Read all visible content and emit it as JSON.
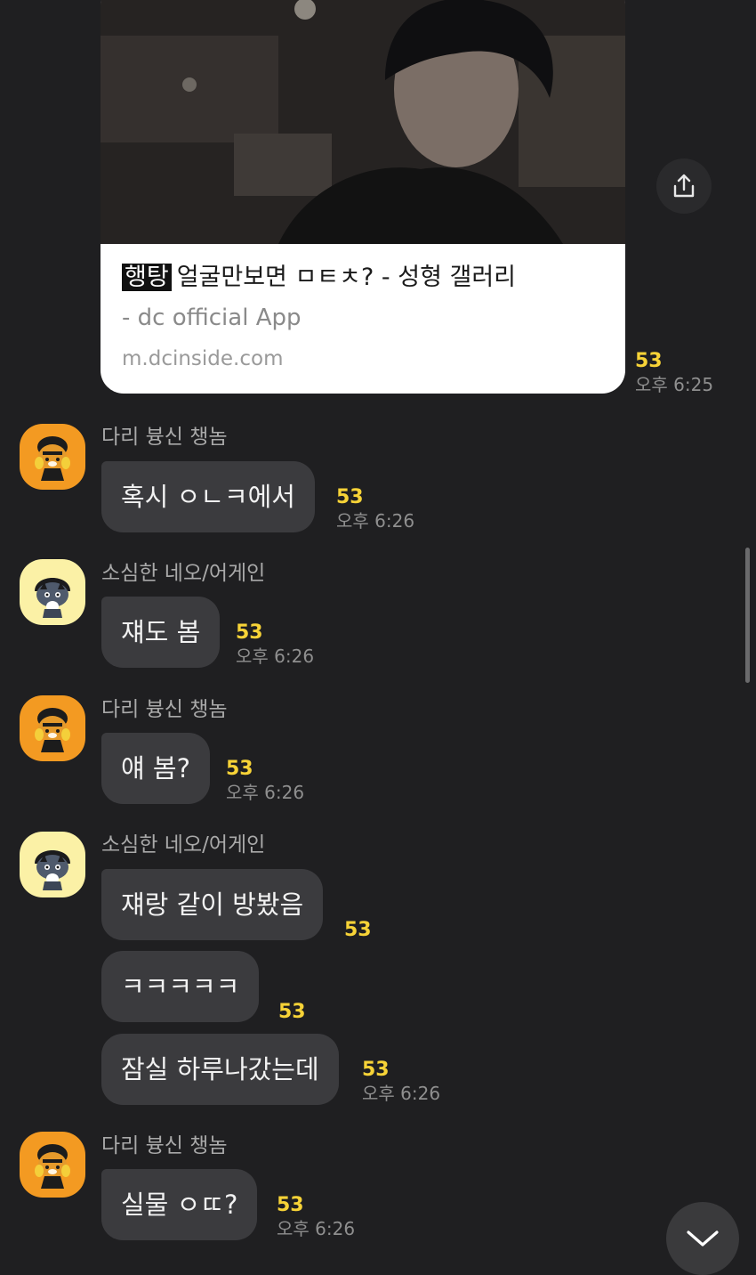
{
  "link_preview": {
    "tag": "행탕",
    "title": "얼굴만보면 ㅁㅌㅊ? - 성형 갤러리",
    "subtitle": "- dc official App",
    "domain": "m.dcinside.com",
    "unread_count": "53",
    "time": "오후 6:25"
  },
  "messages": [
    {
      "sender": "다리 븅신 챙놈",
      "avatar": "ryan",
      "bubbles": [
        {
          "text": "혹시 ㅇㄴㅋ에서",
          "count": "53",
          "time": "오후 6:26"
        }
      ]
    },
    {
      "sender": "소심한 네오/어게인",
      "avatar": "neo",
      "bubbles": [
        {
          "text": "쟤도 봄",
          "count": "53",
          "time": "오후 6:26"
        }
      ]
    },
    {
      "sender": "다리 븅신 챙놈",
      "avatar": "ryan",
      "bubbles": [
        {
          "text": "얘 봄?",
          "count": "53",
          "time": "오후 6:26"
        }
      ]
    },
    {
      "sender": "소심한 네오/어게인",
      "avatar": "neo",
      "bubbles": [
        {
          "text": "쟤랑 같이 방봤음",
          "count": "53"
        },
        {
          "text": "ㅋㅋㅋㅋㅋ",
          "count": "53"
        },
        {
          "text": "잠실 하루나갔는데",
          "count": "53",
          "time": "오후 6:26"
        }
      ]
    },
    {
      "sender": "다리 븅신 챙놈",
      "avatar": "ryan",
      "bubbles": [
        {
          "text": "실물 ㅇㄸ?",
          "count": "53",
          "time": "오후 6:26"
        }
      ]
    }
  ],
  "icons": {
    "share": "share-icon",
    "scroll_down": "chevron-down-icon",
    "avatar_ryan": "ryan-character-avatar",
    "avatar_neo": "neo-character-avatar"
  },
  "colors": {
    "background": "#1f1f21",
    "bubble": "#3b3b3e",
    "unread": "#f7d337"
  }
}
